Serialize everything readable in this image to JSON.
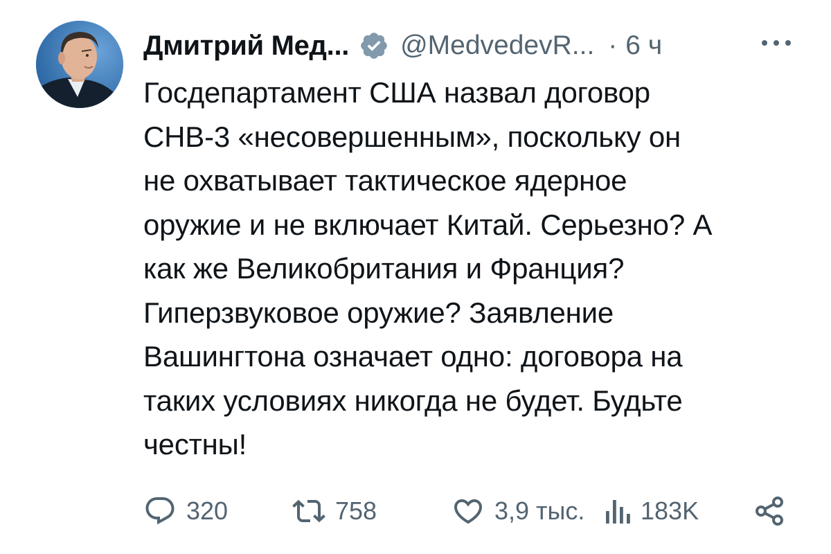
{
  "author": {
    "name": "Дмитрий Мед...",
    "handle": "@MedvedevR...",
    "time_separator": "·",
    "time": "6 ч"
  },
  "icons": {
    "avatar": "profile-photo",
    "verified": "verified-badge-icon",
    "more": "more-options-icon",
    "reply": "reply-icon",
    "retweet": "retweet-icon",
    "like": "heart-icon",
    "views": "views-chart-icon",
    "share": "share-icon"
  },
  "tweet": {
    "text": "Госдепартамент США назвал договор\nСНВ-3 «несовершенным», поскольку он\nне охватывает тактическое ядерное\nоружие и не включает Китай. Серьезно? А\nкак же Великобритания и Франция?\nГиперзвуковое оружие? Заявление\nВашингтона означает одно: договора на\nтаких условиях никогда не будет. Будьте\nчестны!"
  },
  "actions": {
    "replies": "320",
    "retweets": "758",
    "likes": "3,9 тыс.",
    "views": "183K"
  },
  "colors": {
    "text": "#0f1419",
    "secondary": "#536471",
    "verified_badge": "#829aab",
    "background": "#ffffff"
  }
}
